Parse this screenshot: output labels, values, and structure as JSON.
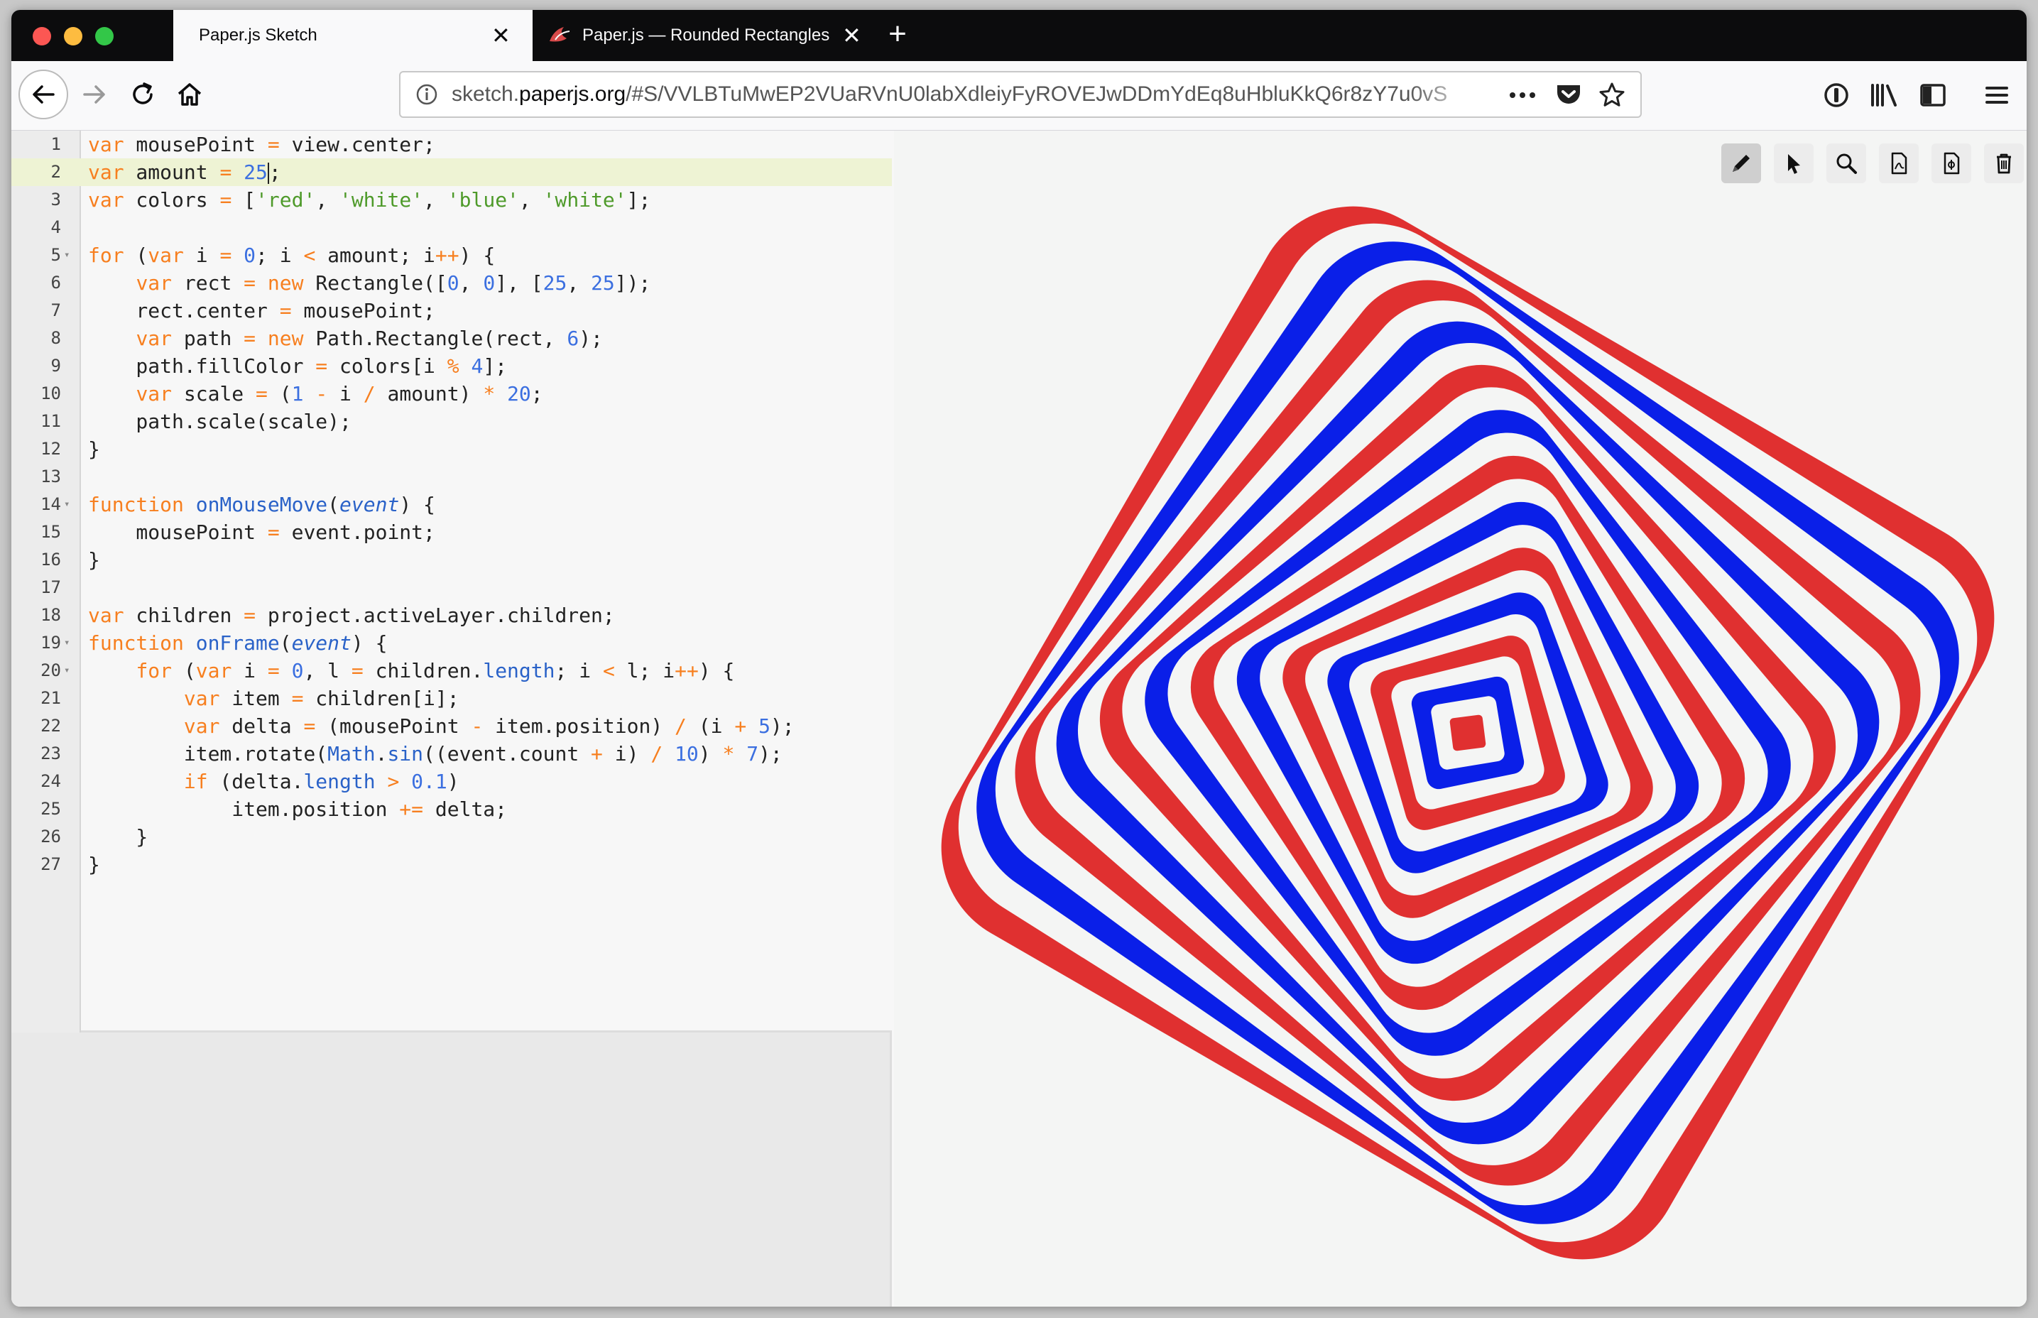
{
  "colors": {
    "red": "#e03030",
    "blue": "#0a1fe8",
    "white": "#f4f5f4",
    "close_btn": "#fc5753",
    "minimize_btn": "#fdbc40",
    "zoom_btn": "#33c748"
  },
  "tabs": [
    {
      "label": "Paper.js Sketch",
      "close": "✕"
    },
    {
      "label": "Paper.js — Rounded Rectangles",
      "close": "✕"
    }
  ],
  "new_tab": "+",
  "urlbar": {
    "prefix": "sketch.",
    "domain": "paperjs.org",
    "path": "/#S/VVLBTuMwEP2VUaRVnU0labXdleiyFyROVEJwDDmYdEq8uHbluKkQ6r8zY7u0vS"
  },
  "editor": {
    "lines": [
      {
        "n": "1",
        "fold": "",
        "code": "<span class=\"kw\">var</span> mousePoint <span class=\"op\">=</span> view.center;"
      },
      {
        "n": "2",
        "fold": "",
        "code": "<span class=\"kw\">var</span> amount <span class=\"op\">=</span> <span class=\"num\">25</span><span class=\"cursor\"></span>;"
      },
      {
        "n": "3",
        "fold": "",
        "code": "<span class=\"kw\">var</span> colors <span class=\"op\">=</span> [<span class=\"str\">'red'</span>, <span class=\"str\">'white'</span>, <span class=\"str\">'blue'</span>, <span class=\"str\">'white'</span>];"
      },
      {
        "n": "4",
        "fold": "",
        "code": ""
      },
      {
        "n": "5",
        "fold": "▾",
        "code": "<span class=\"kw\">for</span> (<span class=\"kw\">var</span> i <span class=\"op\">=</span> <span class=\"num\">0</span>; i <span class=\"op\">&lt;</span> amount; i<span class=\"op\">++</span>) {"
      },
      {
        "n": "6",
        "fold": "",
        "code": "    <span class=\"kw\">var</span> rect <span class=\"op\">=</span> <span class=\"kw\">new</span> Rectangle([<span class=\"num\">0</span>, <span class=\"num\">0</span>], [<span class=\"num\">25</span>, <span class=\"num\">25</span>]);"
      },
      {
        "n": "7",
        "fold": "",
        "code": "    rect.center <span class=\"op\">=</span> mousePoint;"
      },
      {
        "n": "8",
        "fold": "",
        "code": "    <span class=\"kw\">var</span> path <span class=\"op\">=</span> <span class=\"kw\">new</span> Path.Rectangle(rect, <span class=\"num\">6</span>);"
      },
      {
        "n": "9",
        "fold": "",
        "code": "    path.fillColor <span class=\"op\">=</span> colors[i <span class=\"op\">%</span> <span class=\"num\">4</span>];"
      },
      {
        "n": "10",
        "fold": "",
        "code": "    <span class=\"kw\">var</span> scale <span class=\"op\">=</span> (<span class=\"num\">1</span> <span class=\"op\">-</span> i <span class=\"op\">/</span> amount) <span class=\"op\">*</span> <span class=\"num\">20</span>;"
      },
      {
        "n": "11",
        "fold": "",
        "code": "    path.scale(scale);"
      },
      {
        "n": "12",
        "fold": "",
        "code": "}"
      },
      {
        "n": "13",
        "fold": "",
        "code": ""
      },
      {
        "n": "14",
        "fold": "▾",
        "code": "<span class=\"kw\">function</span> <span class=\"fn\">onMouseMove</span>(<span class=\"arg\">event</span>) {"
      },
      {
        "n": "15",
        "fold": "",
        "code": "    mousePoint <span class=\"op\">=</span> event.point;"
      },
      {
        "n": "16",
        "fold": "",
        "code": "}"
      },
      {
        "n": "17",
        "fold": "",
        "code": ""
      },
      {
        "n": "18",
        "fold": "",
        "code": "<span class=\"kw\">var</span> children <span class=\"op\">=</span> project.activeLayer.children;"
      },
      {
        "n": "19",
        "fold": "▾",
        "code": "<span class=\"kw\">function</span> <span class=\"fn\">onFrame</span>(<span class=\"arg\">event</span>) {"
      },
      {
        "n": "20",
        "fold": "▾",
        "code": "    <span class=\"kw\">for</span> (<span class=\"kw\">var</span> i <span class=\"op\">=</span> <span class=\"num\">0</span>, l <span class=\"op\">=</span> children.<span class=\"prop\">length</span>; i <span class=\"op\">&lt;</span> l; i<span class=\"op\">++</span>) {"
      },
      {
        "n": "21",
        "fold": "",
        "code": "        <span class=\"kw\">var</span> item <span class=\"op\">=</span> children[i];"
      },
      {
        "n": "22",
        "fold": "",
        "code": "        <span class=\"kw\">var</span> delta <span class=\"op\">=</span> (mousePoint <span class=\"op\">-</span> item.position) <span class=\"op\">/</span> (i <span class=\"op\">+</span> <span class=\"num\">5</span>);"
      },
      {
        "n": "23",
        "fold": "",
        "code": "        item.rotate(<span class=\"prop\">Math</span>.<span class=\"prop\">sin</span>((event.count <span class=\"op\">+</span> i) <span class=\"op\">/</span> <span class=\"num\">10</span>) <span class=\"op\">*</span> <span class=\"num\">7</span>);"
      },
      {
        "n": "24",
        "fold": "",
        "code": "        <span class=\"kw\">if</span> (delta.<span class=\"prop\">length</span> <span class=\"op\">&gt;</span> <span class=\"num\">0.1</span>)"
      },
      {
        "n": "25",
        "fold": "",
        "code": "            item.position <span class=\"op\">+=</span> delta;"
      },
      {
        "n": "26",
        "fold": "",
        "code": "    }"
      },
      {
        "n": "27",
        "fold": "",
        "code": "}"
      }
    ],
    "highlighted_line": 2
  },
  "canvas": {
    "tools": [
      "pencil-icon",
      "pointer-icon",
      "zoom-icon",
      "pdf-export-icon",
      "svg-export-icon",
      "trash-icon"
    ],
    "selected_tool": "pencil-icon",
    "sketch": {
      "amount": 25,
      "color_cycle": [
        "red",
        "white",
        "blue",
        "white"
      ],
      "rotation_deg": 30,
      "swirl_deg_per_layer": 2.2
    }
  }
}
